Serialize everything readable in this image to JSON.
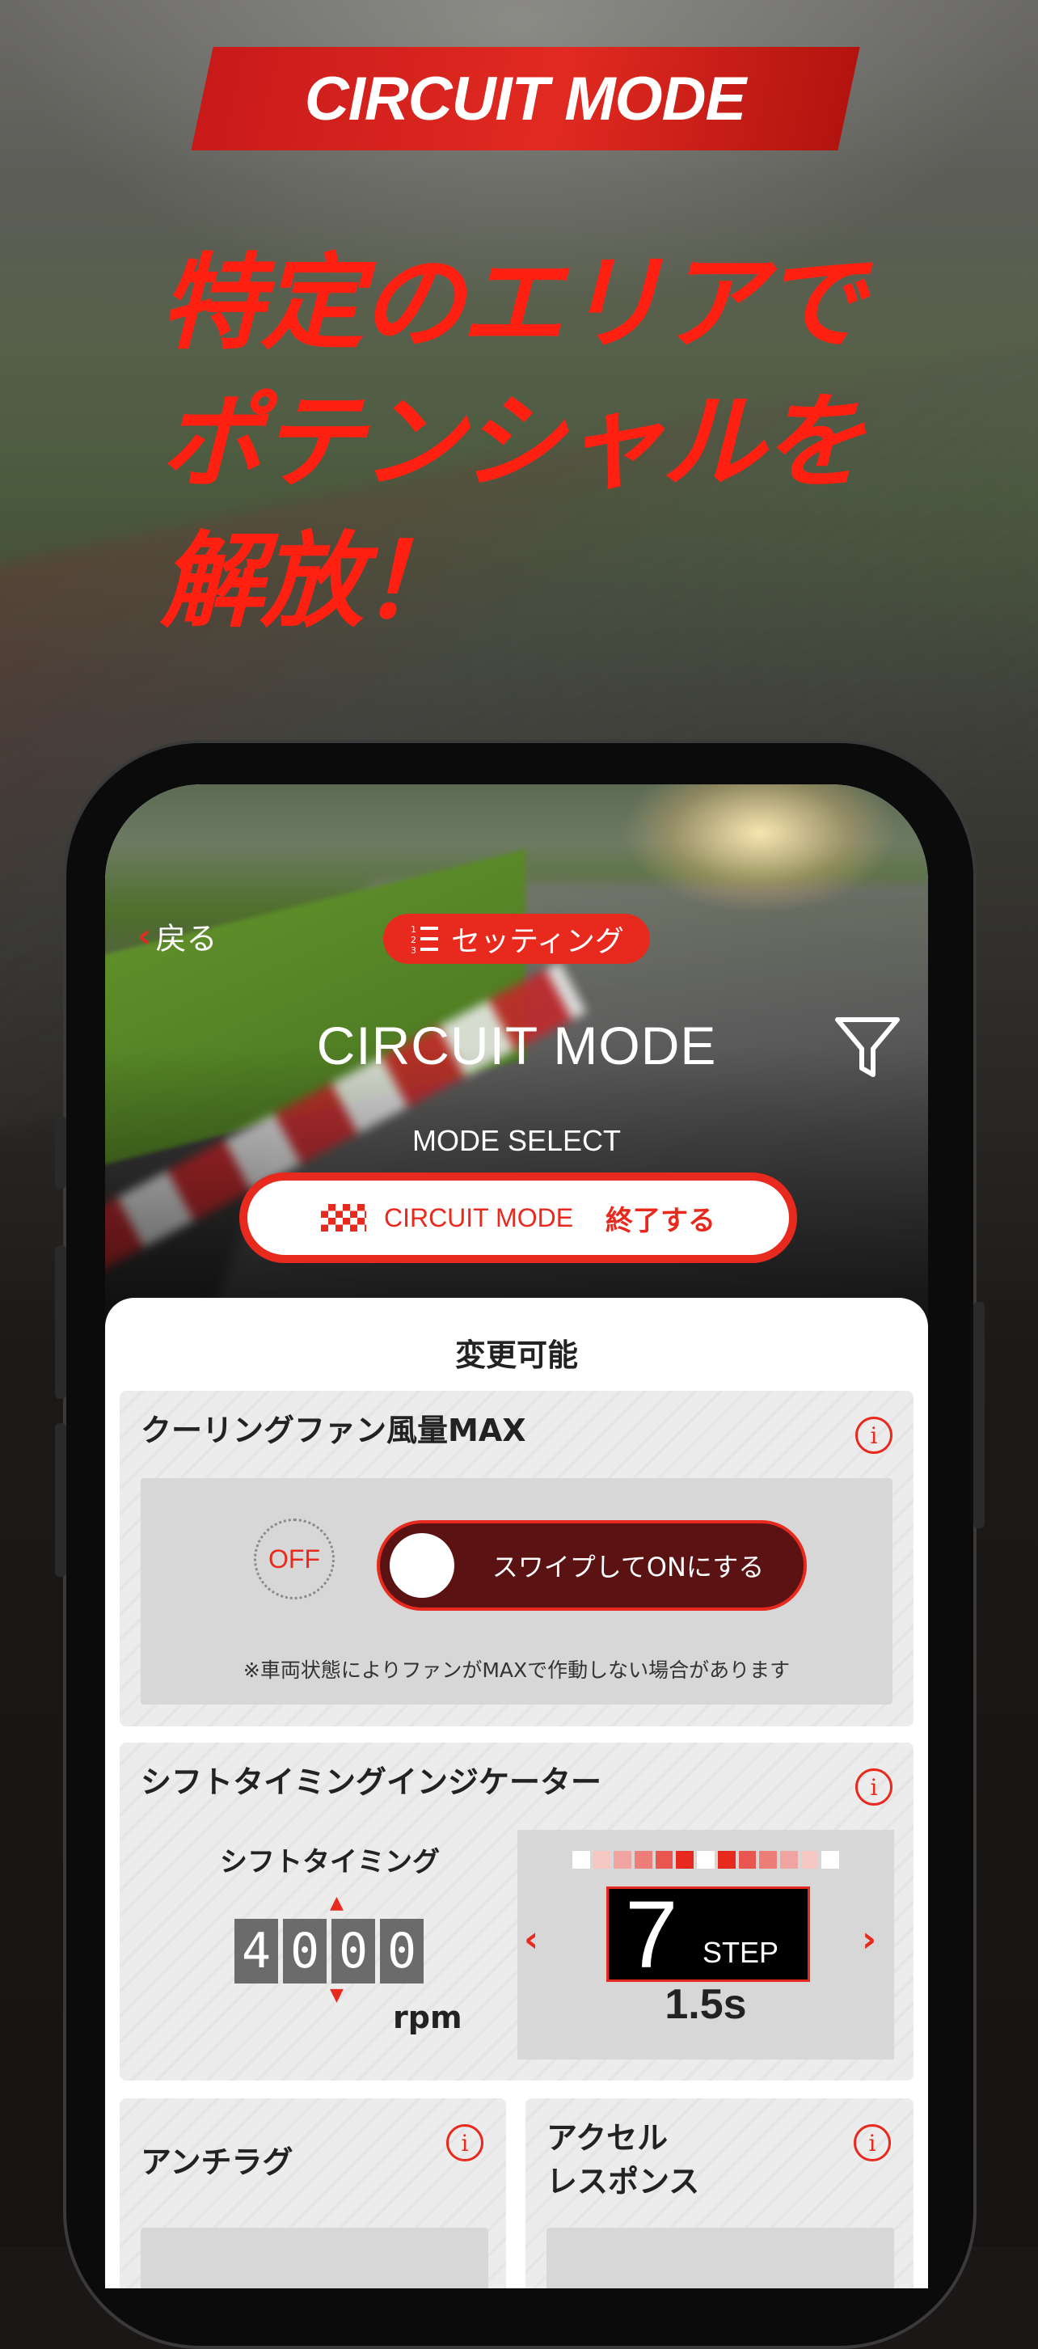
{
  "banner": {
    "title": "CIRCUIT MODE"
  },
  "headline": {
    "line1": "特定のエリアで",
    "line2": "ポテンシャルを",
    "line3": "解放！"
  },
  "app": {
    "back_label": "戻る",
    "settings_pill": "セッティング",
    "screen_title": "CIRCUIT MODE",
    "mode_select_label": "MODE SELECT",
    "mode_button": {
      "mode": "CIRCUIT MODE",
      "action": "終了する"
    },
    "section_header": "変更可能",
    "cooling_fan": {
      "title": "クーリングファン風量MAX",
      "state": "OFF",
      "swipe_label": "スワイプしてONにする",
      "note": "※車両状態によりファンがMAXで作動しない場合があります"
    },
    "shift_indicator": {
      "title": "シフトタイミングインジケーター",
      "timing_label": "シフトタイミング",
      "digits": [
        "4",
        "0",
        "0",
        "0"
      ],
      "unit": "rpm",
      "step_value": "7",
      "step_label": "STEP",
      "seconds": "1.5s"
    },
    "anti_lag": {
      "title": "アンチラグ"
    },
    "accel_response": {
      "title_line1": "アクセル",
      "title_line2": "レスポンス"
    },
    "colors": {
      "accent": "#e8291e",
      "dark_red": "#5a1213"
    }
  }
}
